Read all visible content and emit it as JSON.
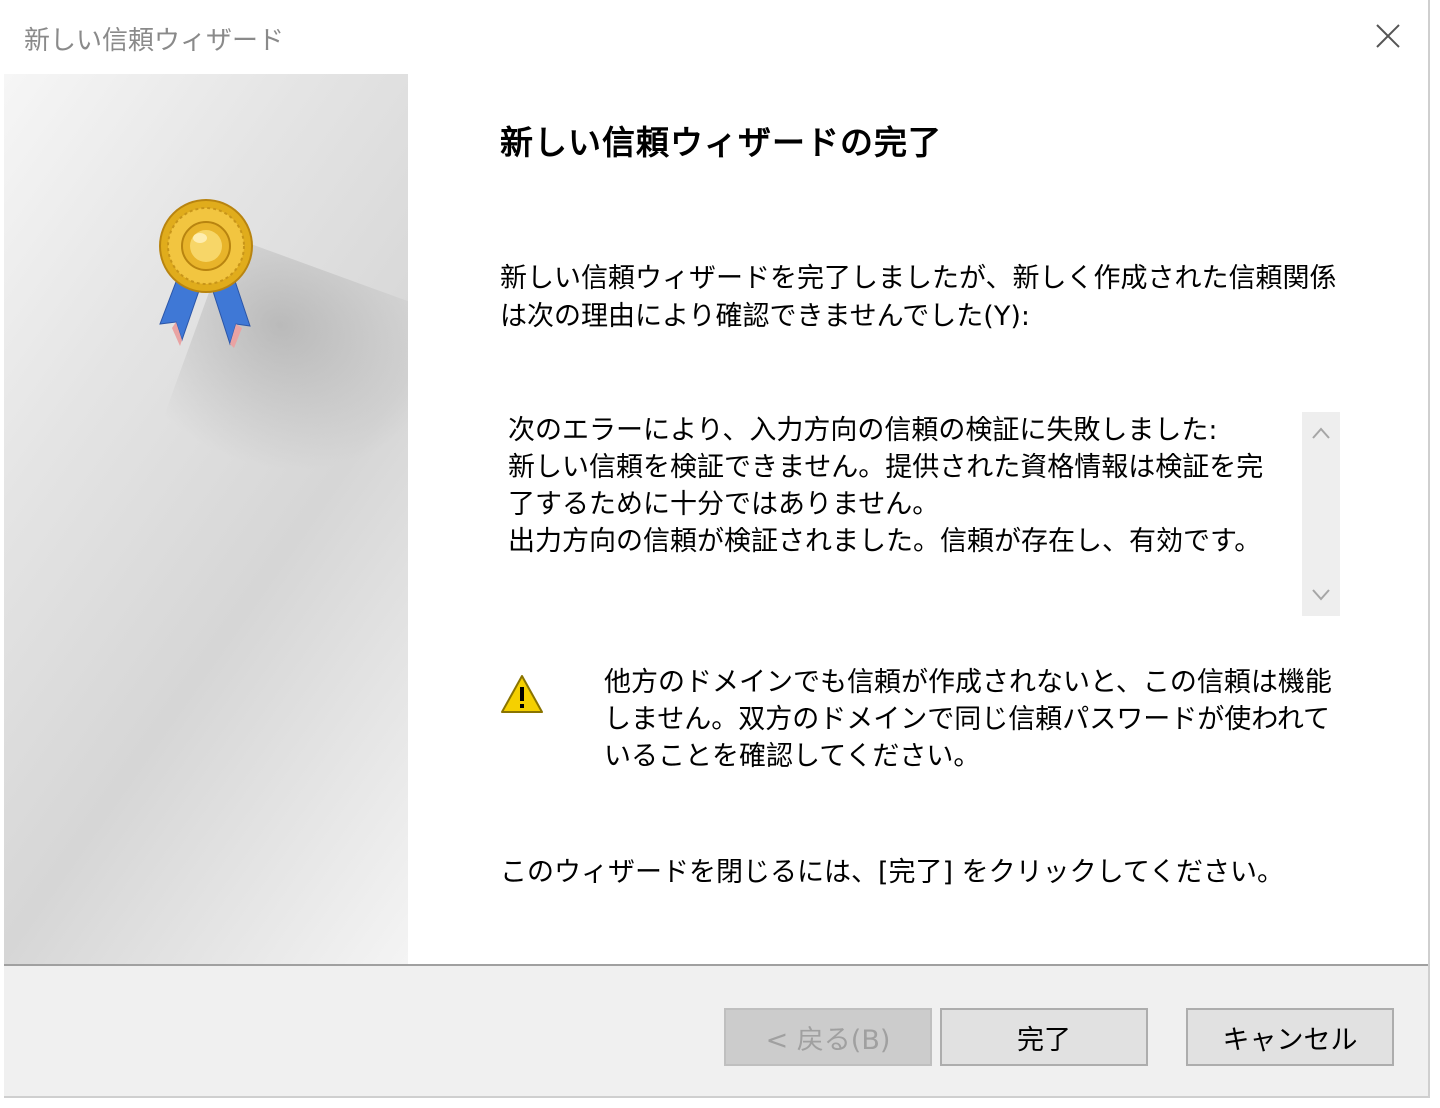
{
  "window": {
    "title": "新しい信頼ウィザード"
  },
  "content": {
    "heading": "新しい信頼ウィザードの完了",
    "intro": "新しい信頼ウィザードを完了しましたが、新しく作成された信頼関係は次の理由により確認できませんでした(Y):",
    "error_text": "次のエラーにより、入力方向の信頼の検証に失敗しました:\n新しい信頼を検証できません。提供された資格情報は検証を完了するために十分ではありません。\n出力方向の信頼が検証されました。信頼が存在し、有効です。",
    "warning_text": "他方のドメインでも信頼が作成されないと、この信頼は機能しません。双方のドメインで同じ信頼パスワードが使われていることを確認してください。",
    "footer_note": "このウィザードを閉じるには、[完了] をクリックしてください。"
  },
  "buttons": {
    "back_label": "< 戻る(B)",
    "back_enabled": false,
    "finish_label": "完了",
    "cancel_label": "キャンセル"
  },
  "icons": {
    "close": "close-icon",
    "medal": "certificate-medal-icon",
    "warning": "warning-icon",
    "scroll_up": "chevron-up-icon",
    "scroll_down": "chevron-down-icon"
  },
  "colors": {
    "title_text": "#8a8a8a",
    "button_bar": "#f0f0f0",
    "warning_yellow": "#f5d000"
  }
}
